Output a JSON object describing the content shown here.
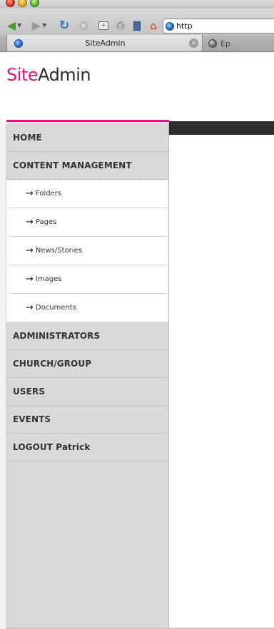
{
  "browser": {
    "url_text": "http",
    "active_tab": {
      "title": "SiteAdmin"
    },
    "inactive_tab": {
      "title": "Ep"
    },
    "icons": [
      "back-arrow-icon",
      "forward-arrow-icon",
      "reload-icon",
      "stop-icon",
      "new-tab-icon",
      "print-icon",
      "bookmarks-icon",
      "home-icon",
      "globe-icon"
    ]
  },
  "site": {
    "logo": {
      "part1": "Site",
      "part2": "Admin"
    },
    "brand_color": "#e0157a",
    "header_bar_color": "#2d2d2d"
  },
  "nav": {
    "home": "HOME",
    "content_management": "CONTENT MANAGEMENT",
    "sub_items": [
      "Folders",
      "Pages",
      "News/Stories",
      "Images",
      "Documents"
    ],
    "arrow": "→",
    "administrators": "ADMINISTRATORS",
    "church_group": "CHURCH/GROUP",
    "users": "USERS",
    "events": "EVENTS",
    "logout": "LOGOUT Patrick"
  }
}
